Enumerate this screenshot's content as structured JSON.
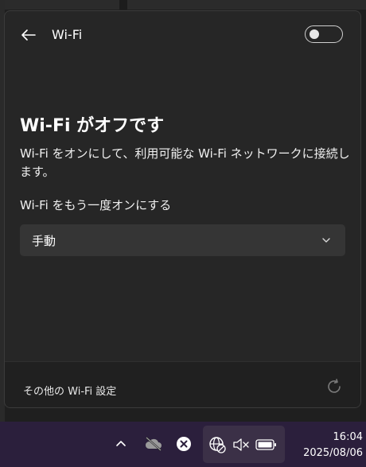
{
  "header": {
    "title": "Wi-Fi",
    "toggle_state": "off"
  },
  "content": {
    "heading": "Wi-Fi がオフです",
    "description": "Wi-Fi をオンにして、利用可能な Wi-Fi ネットワークに接続します。",
    "turn_on_again_label": "Wi-Fi をもう一度オンにする",
    "turn_on_again_selected": "手動"
  },
  "footer": {
    "more_settings": "その他の Wi-Fi 設定"
  },
  "taskbar": {
    "time": "16:04",
    "date": "2025/08/06"
  },
  "icons": [
    "back-arrow-icon",
    "chevron-down-icon",
    "refresh-icon",
    "chevron-up-icon",
    "cloud-off-icon",
    "error-x-icon",
    "globe-no-internet-icon",
    "speaker-muted-icon",
    "battery-icon"
  ],
  "colors": {
    "panel": "#262626",
    "footer": "#202020",
    "taskbar": "#2b1f3c",
    "dropdown": "#353535"
  }
}
